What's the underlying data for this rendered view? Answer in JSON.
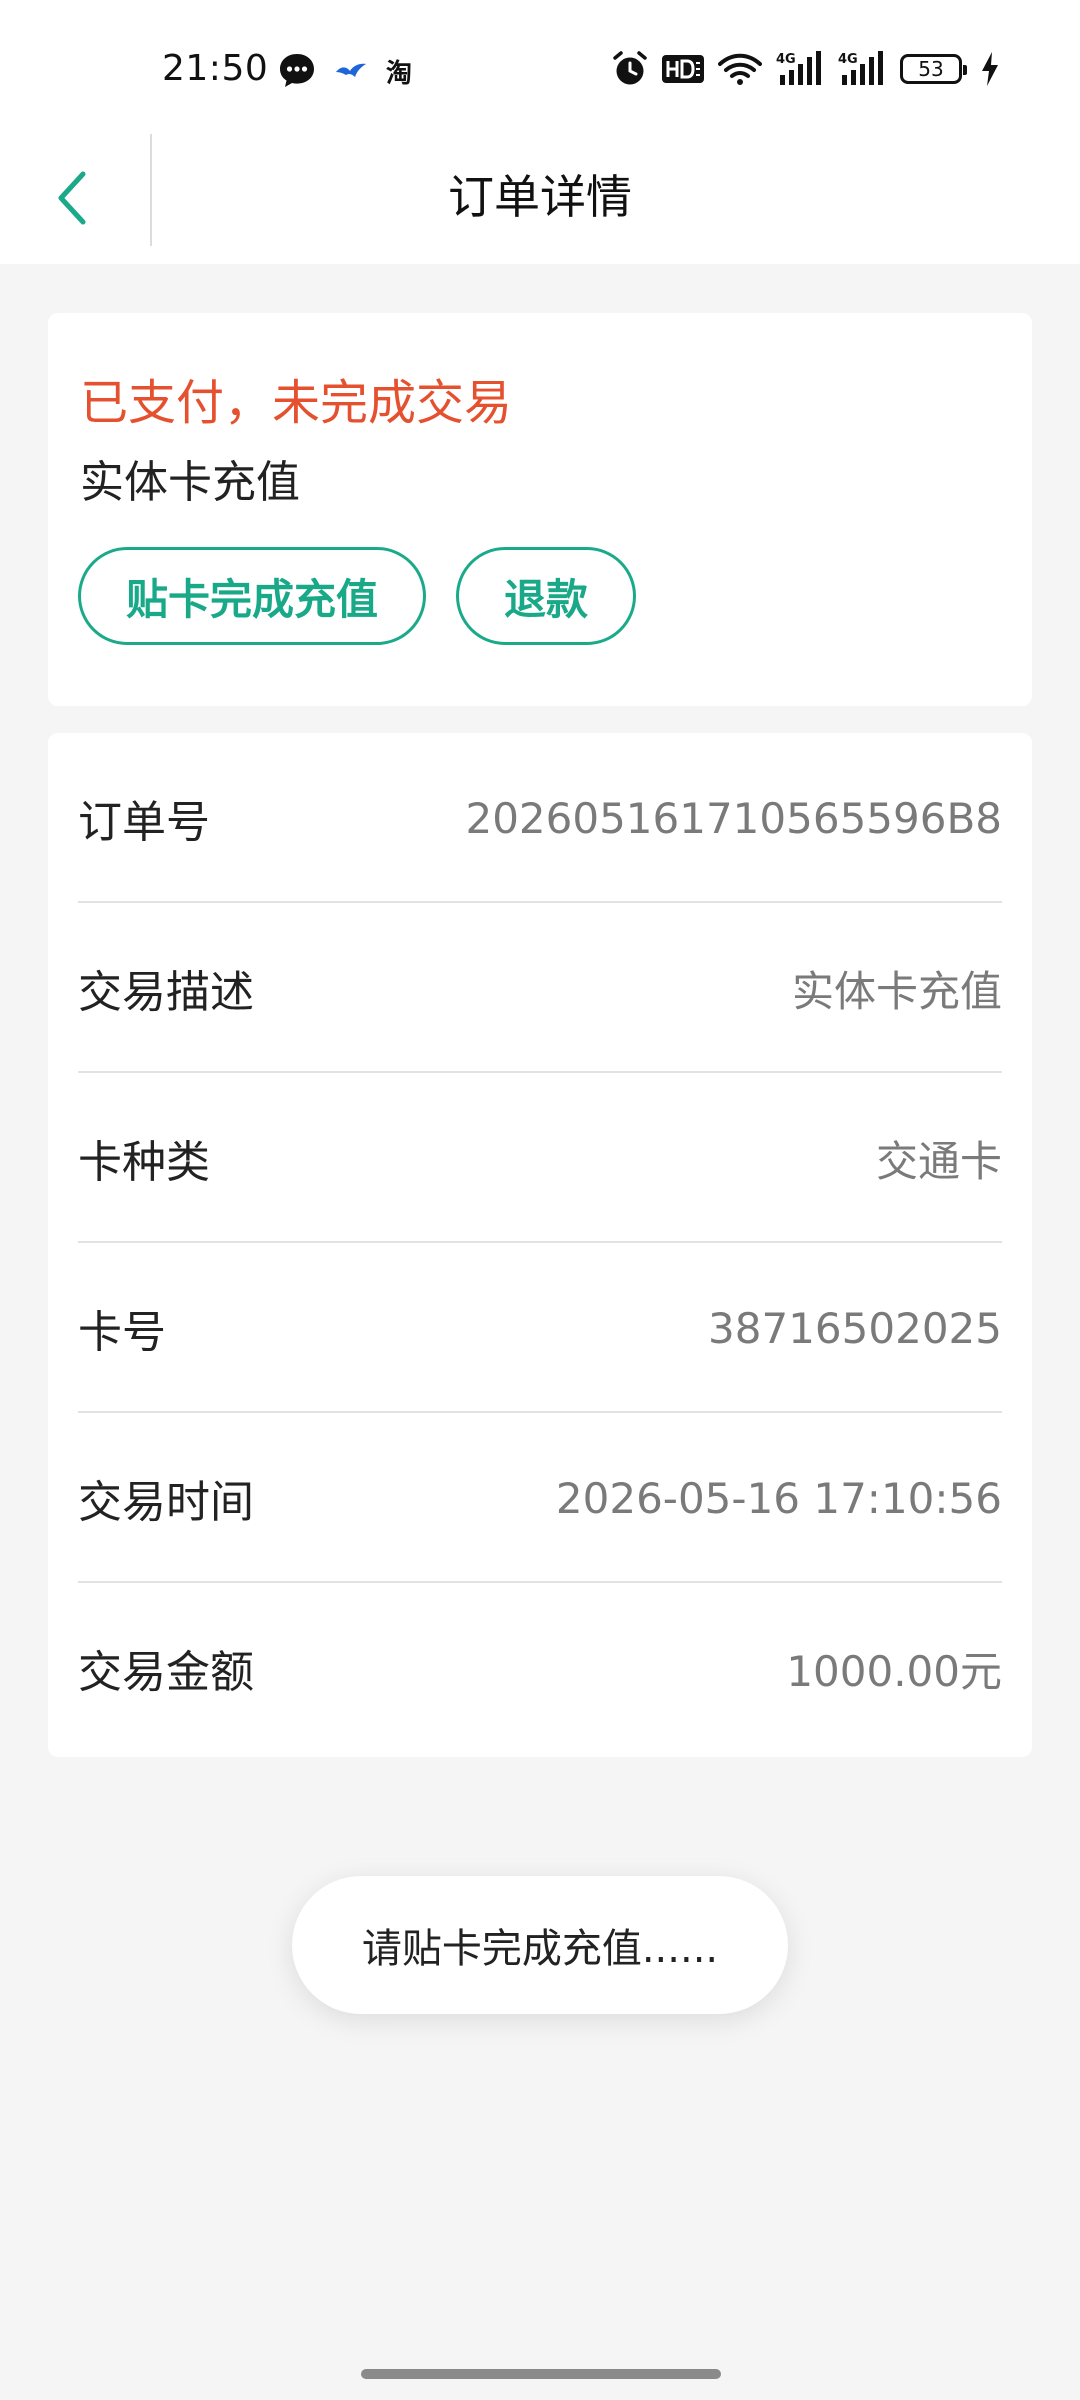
{
  "status_bar": {
    "time": "21:50",
    "taobao_glyph": "淘",
    "battery_level": "53",
    "icons": [
      "chat-bubble-icon",
      "bird-icon",
      "taobao-icon",
      "alarm-icon",
      "hd-icon",
      "wifi-icon",
      "signal-4g-icon",
      "signal-4g-icon",
      "battery-icon",
      "charging-icon"
    ]
  },
  "header": {
    "title": "订单详情",
    "back_icon": "chevron-left-icon",
    "accent_color": "#1aaa8a"
  },
  "status_card": {
    "status_text": "已支付，未完成交易",
    "status_color": "#e5502f",
    "subtitle": "实体卡充值",
    "recharge_button": "贴卡完成充值",
    "refund_button": "退款"
  },
  "details": {
    "rows": [
      {
        "label": "订单号",
        "value": "202605161710565596B8"
      },
      {
        "label": "交易描述",
        "value": "实体卡充值"
      },
      {
        "label": "卡种类",
        "value": "交通卡"
      },
      {
        "label": "卡号",
        "value": "38716502025"
      },
      {
        "label": "交易时间",
        "value": "2026-05-16 17:10:56"
      },
      {
        "label": "交易金额",
        "value": "1000.00元"
      }
    ]
  },
  "toast": {
    "message": "请贴卡完成充值......"
  }
}
